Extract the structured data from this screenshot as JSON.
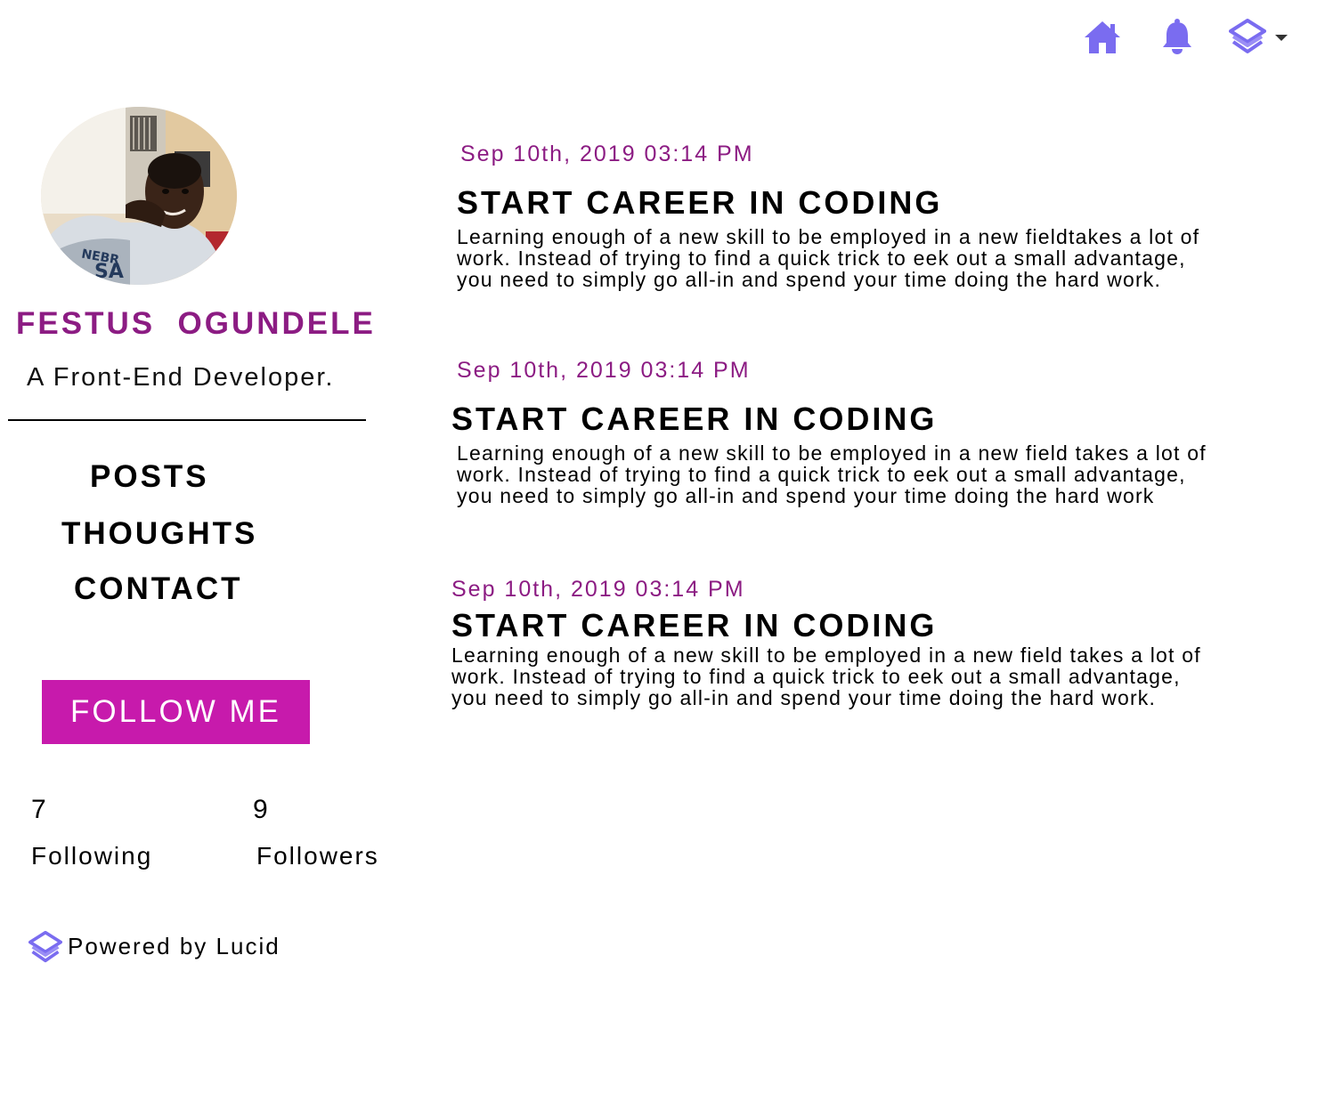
{
  "header": {
    "icons": [
      "home-icon",
      "bell-icon",
      "lucid-logo-icon",
      "caret-down-icon"
    ],
    "accent_color": "#7a6cf0"
  },
  "profile": {
    "name": "FESTUS  OGUNDELE",
    "tagline": "A Front-End Developer.",
    "name_color": "#8c1c83"
  },
  "sidebar": {
    "nav": [
      {
        "label": "POSTS"
      },
      {
        "label": "THOUGHTS"
      },
      {
        "label": "CONTACT"
      }
    ],
    "follow_label": "FOLLOW ME",
    "follow_color": "#c71aac",
    "stats": {
      "following_count": "7",
      "following_label": "Following",
      "followers_count": "9",
      "followers_label": "Followers"
    },
    "powered_by": "Powered by Lucid"
  },
  "posts": [
    {
      "date": "Sep 10th, 2019 03:14 PM",
      "title": "START CAREER IN CODING",
      "body_lines": [
        "Learning enough of a new skill to be employed in a new fieldtakes a lot of",
        "work. Instead of trying to find a quick trick to eek out a small advantage,",
        "you need to simply go all-in and spend your time doing the hard work."
      ]
    },
    {
      "date": "Sep 10th, 2019 03:14 PM",
      "title": "START CAREER IN CODING",
      "body_lines": [
        "Learning enough of a new skill to be employed in a new field takes a lot of",
        "work. Instead of trying to find a quick trick to eek out a small advantage,",
        "you need to simply go all-in and spend your time doing the hard work"
      ]
    },
    {
      "date": "Sep 10th, 2019 03:14 PM",
      "title": "START CAREER IN CODING",
      "body_lines": [
        "Learning enough of a new skill to be employed in a new field takes a lot of",
        "work. Instead of trying to find a quick trick to eek out a small advantage,",
        "you need to simply go all-in and spend your time doing the hard work."
      ]
    }
  ]
}
